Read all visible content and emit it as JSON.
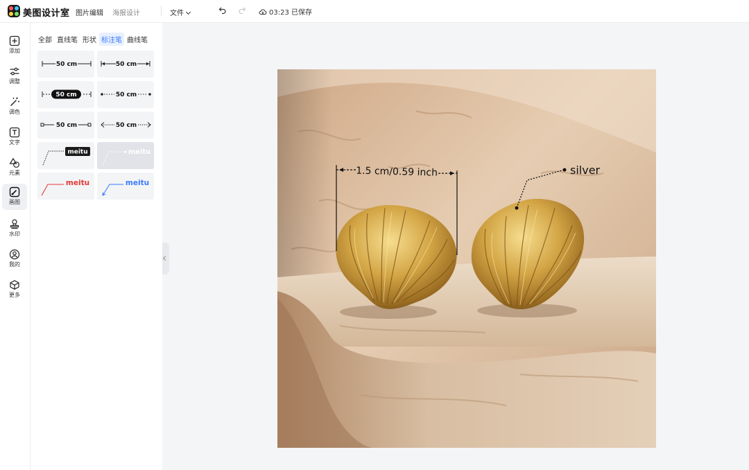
{
  "app": {
    "brand": "美图设计室",
    "tabs": [
      "图片编辑",
      "海报设计"
    ],
    "file_menu": "文件",
    "save_status": "03:23 已保存"
  },
  "rail": {
    "items": [
      {
        "label": "添加",
        "icon": "plus-square-icon"
      },
      {
        "label": "调整",
        "icon": "sliders-icon"
      },
      {
        "label": "调色",
        "icon": "magic-wand-icon"
      },
      {
        "label": "文字",
        "icon": "text-icon"
      },
      {
        "label": "元素",
        "icon": "shapes-icon"
      },
      {
        "label": "画图",
        "icon": "brush-icon",
        "active": true
      },
      {
        "label": "水印",
        "icon": "stamp-icon"
      },
      {
        "label": "我的",
        "icon": "user-icon"
      },
      {
        "label": "更多",
        "icon": "cube-icon"
      }
    ]
  },
  "panel": {
    "tabs": [
      "全部",
      "直线笔",
      "形状",
      "标注笔",
      "曲线笔"
    ],
    "active_tab": "标注笔",
    "tiles": {
      "dim_label": "50 cm",
      "callout_label": "meitu"
    }
  },
  "canvas": {
    "annotation_measure": "1.5 cm/0.59 inch",
    "annotation_material": "silver"
  },
  "colors": {
    "accent": "#3a7bff",
    "red_stroke": "#e53935",
    "blue_stroke": "#3a7bff"
  }
}
